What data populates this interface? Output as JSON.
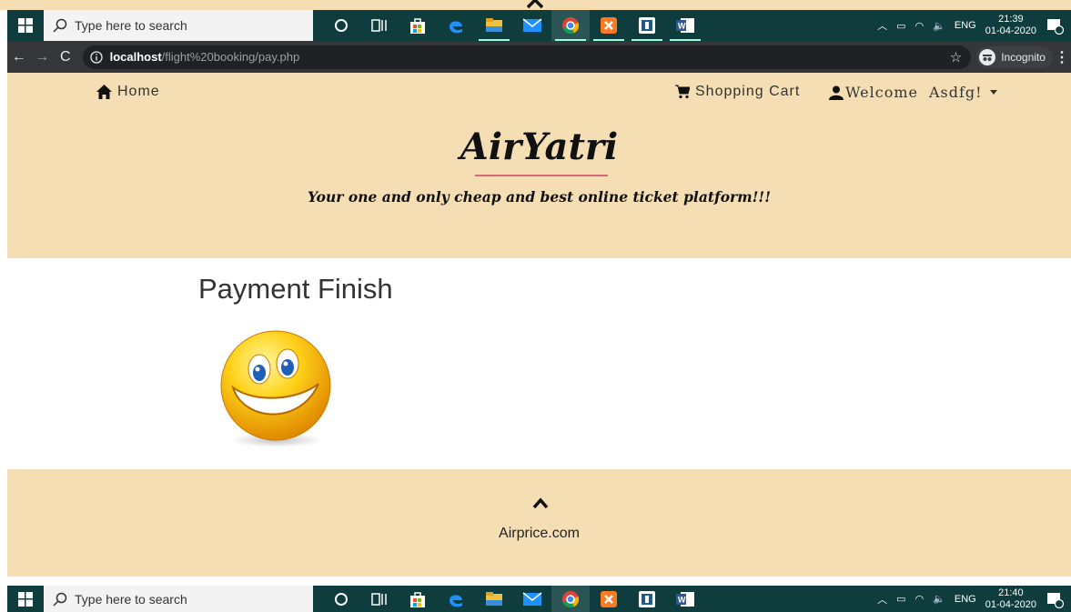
{
  "taskbar_top": {
    "search_placeholder": "Type here to search",
    "language": "ENG",
    "time": "21:39",
    "date": "01-04-2020"
  },
  "taskbar_bottom": {
    "search_placeholder": "Type here to search",
    "language": "ENG",
    "time": "21:40",
    "date": "01-04-2020"
  },
  "browser": {
    "url_host": "localhost",
    "url_path": "/flight%20booking/pay.php",
    "mode_label": "Incognito"
  },
  "nav": {
    "home_label": "Home",
    "cart_label": "Shopping Cart",
    "welcome_label": "Welcome",
    "user_name": "Asdfg!"
  },
  "header": {
    "brand": "AirYatri",
    "tagline": "Your one and only cheap and best online ticket platform!!!"
  },
  "main": {
    "title": "Payment Finish"
  },
  "footer": {
    "text": "Airprice.com"
  },
  "colors": {
    "header_bg": "#f5deb3",
    "taskbar_bg": "#0f3d3d",
    "accent_line": "#d9687a"
  }
}
